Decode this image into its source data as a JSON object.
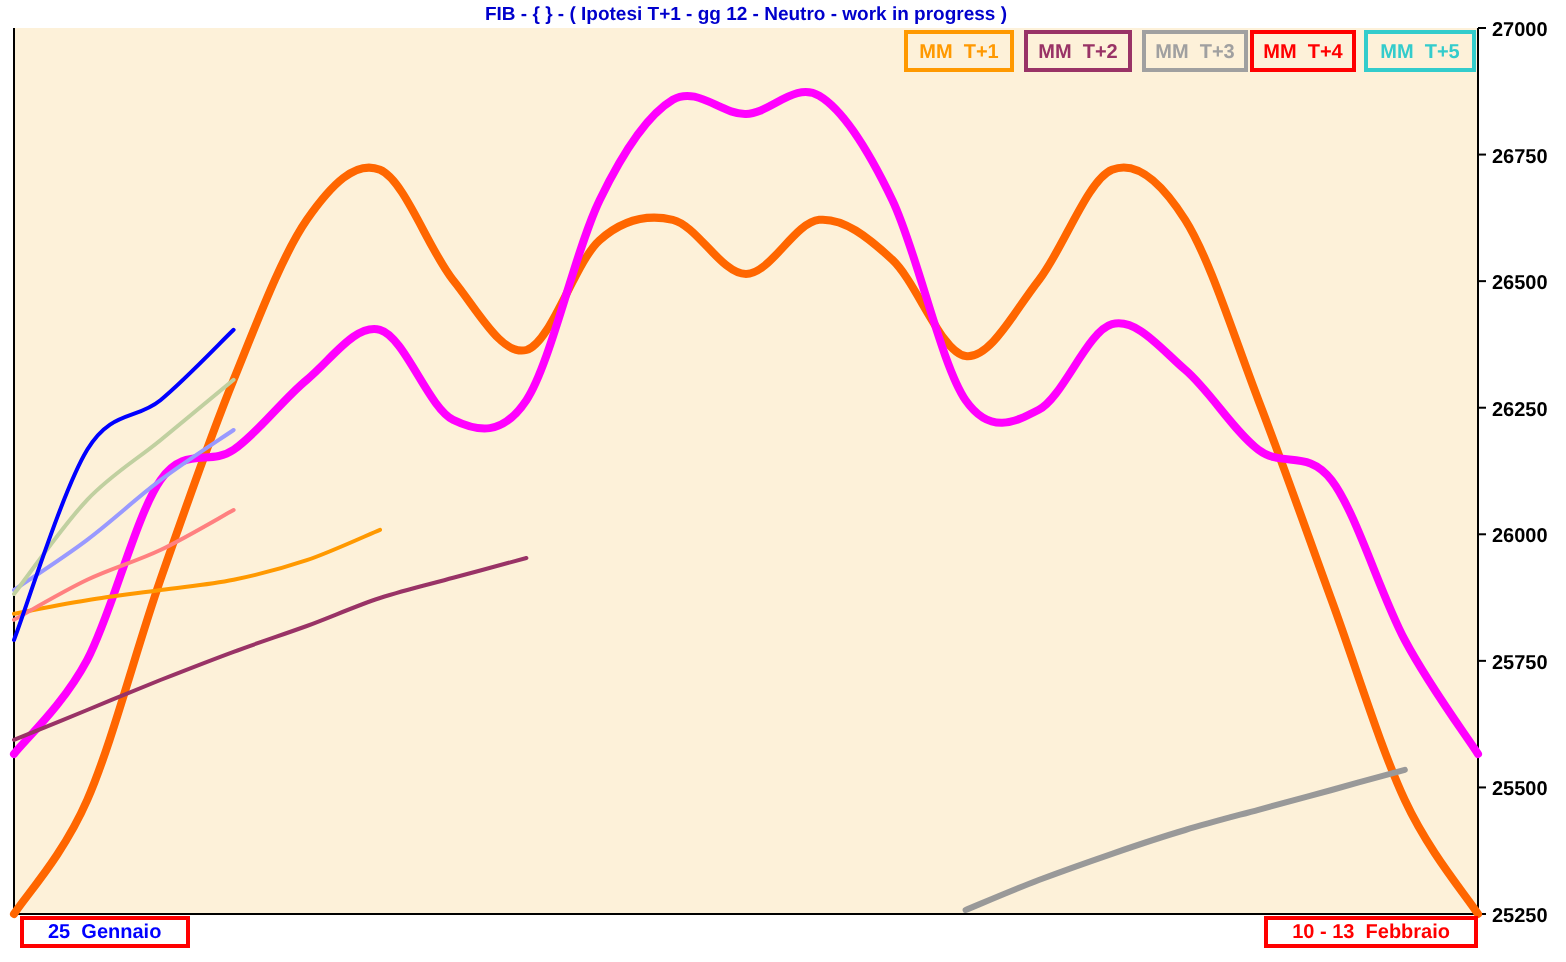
{
  "chart": {
    "chart_data": {
      "type": "line",
      "title": "FIB  - { } - ( Ipotesi T+1 - gg 12 - Neutro - work in progress )",
      "ylim": [
        25250,
        27000
      ],
      "yticks": [
        25250,
        25500,
        25750,
        26000,
        26250,
        26500,
        26750,
        27000
      ],
      "series": [
        {
          "color": "#ff6600",
          "values": [
            25250,
            25475,
            25910,
            26305,
            26621,
            26720,
            26502,
            26364,
            26581,
            26621,
            26514,
            26621,
            26542,
            26352,
            26502,
            26720,
            26621,
            26265,
            25870,
            25475,
            25250
          ]
        },
        {
          "color": "#ff00ff",
          "values": [
            25566,
            25752,
            26107,
            26167,
            26305,
            26404,
            26226,
            26265,
            26660,
            26858,
            26830,
            26866,
            26660,
            26265,
            26246,
            26415,
            26325,
            26167,
            26107,
            25791,
            25566
          ]
        },
        {
          "color": "#999999",
          "values": [
            null,
            null,
            null,
            null,
            null,
            null,
            null,
            null,
            null,
            null,
            null,
            null,
            null,
            25258,
            25317,
            25369,
            25416,
            25456,
            25495,
            25535,
            null
          ]
        },
        {
          "color": "#993366",
          "values": [
            25594,
            25653,
            25712,
            25768,
            25819,
            25874,
            25914,
            25953,
            null,
            null,
            null,
            null,
            null,
            null,
            null,
            null,
            null,
            null,
            null,
            null,
            null
          ]
        },
        {
          "color": "#ff9900",
          "values": [
            25843,
            25870,
            25890,
            25910,
            25949,
            26009,
            null,
            null,
            null,
            null,
            null,
            null,
            null,
            null,
            null,
            null,
            null,
            null,
            null,
            null,
            null
          ]
        },
        {
          "color": "#ff8080",
          "values": [
            25831,
            25910,
            25969,
            26048,
            null,
            null,
            null,
            null,
            null,
            null,
            null,
            null,
            null,
            null,
            null,
            null,
            null,
            null,
            null,
            null,
            null
          ]
        },
        {
          "color": "#9999ff",
          "values": [
            25890,
            25989,
            26107,
            26206,
            null,
            null,
            null,
            null,
            null,
            null,
            null,
            null,
            null,
            null,
            null,
            null,
            null,
            null,
            null,
            null,
            null
          ]
        },
        {
          "color": "#c0d0a0",
          "values": [
            25882,
            26068,
            26186,
            26305,
            null,
            null,
            null,
            null,
            null,
            null,
            null,
            null,
            null,
            null,
            null,
            null,
            null,
            null,
            null,
            null,
            null
          ]
        },
        {
          "color": "#0000ff",
          "values": [
            25791,
            26167,
            26265,
            26404,
            null,
            null,
            null,
            null,
            null,
            null,
            null,
            null,
            null,
            null,
            null,
            null,
            null,
            null,
            null,
            null,
            null
          ]
        }
      ]
    },
    "legend": [
      {
        "label": "MM  T+1",
        "color": "#ff9900"
      },
      {
        "label": "MM  T+2",
        "color": "#993366"
      },
      {
        "label": "MM  T+3",
        "color": "#a0a0a0"
      },
      {
        "label": "MM  T+4",
        "color": "#ff0000"
      },
      {
        "label": "MM  T+5",
        "color": "#33cccc"
      }
    ]
  },
  "date_labels": [
    {
      "text": "25  Gennaio",
      "color": "#0000ff"
    },
    {
      "text": "10 - 13  Febbraio",
      "color": "#ff0000"
    }
  ]
}
